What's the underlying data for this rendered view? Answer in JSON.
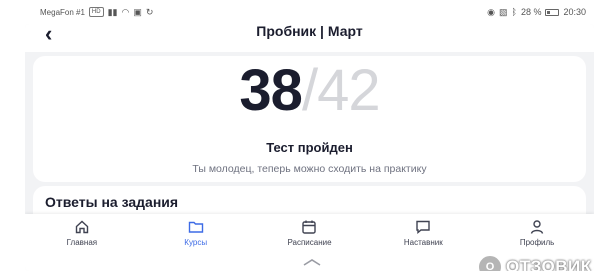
{
  "status_bar": {
    "carrier": "MegaFon #1",
    "network_badge": "HD",
    "battery": "28 %",
    "time": "20:30"
  },
  "header": {
    "back_icon": "chevron-left-icon",
    "title": "Пробник | Март"
  },
  "result": {
    "score": "38",
    "separator": "/",
    "total": "42",
    "title": "Тест пройден",
    "subtitle": "Ты молодец, теперь можно сходить на практику"
  },
  "answers": {
    "heading": "Ответы на задания"
  },
  "tabs": [
    {
      "label": "Главная",
      "icon": "home-icon",
      "active": false
    },
    {
      "label": "Курсы",
      "icon": "folder-icon",
      "active": true
    },
    {
      "label": "Расписание",
      "icon": "calendar-icon",
      "active": false
    },
    {
      "label": "Наставник",
      "icon": "chat-icon",
      "active": false
    },
    {
      "label": "Профиль",
      "icon": "user-icon",
      "active": false
    }
  ],
  "watermark": {
    "mark": "O",
    "text": "ОТЗОВИК"
  },
  "colors": {
    "accent": "#3d6be6",
    "text_dark": "#1b1d2e",
    "text_muted": "#6f7280",
    "score_total": "#d5d6da",
    "background": "#f2f3f5"
  }
}
